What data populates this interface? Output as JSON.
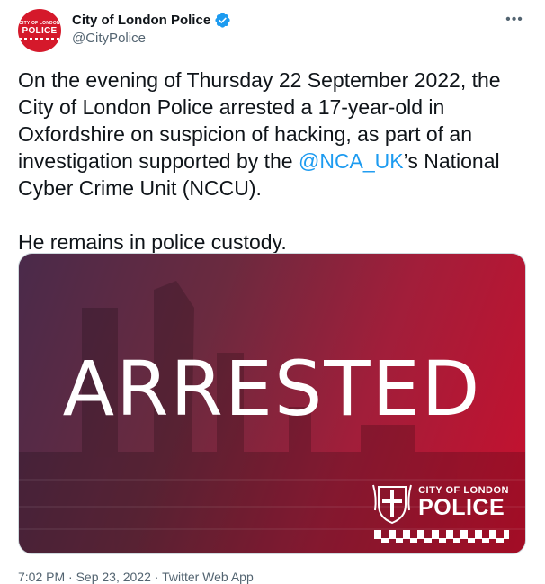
{
  "author": {
    "display_name": "City of London Police",
    "handle": "@CityPolice",
    "avatar_text_small": "CITY OF LONDON",
    "avatar_text_big": "POLICE"
  },
  "icons": {
    "verified": "verified-badge-icon",
    "more": "more-options-icon",
    "crest": "city-of-london-crest-icon"
  },
  "tweet": {
    "text_part1": "On the evening of Thursday 22 September 2022, the City of London Police arrested a 17-year-old in Oxfordshire on suspicion of hacking, as part of an investigation supported by the ",
    "mention": "@NCA_UK",
    "text_part2": "’s National Cyber Crime Unit (NCCU).",
    "paragraph2": "He remains in police custody."
  },
  "media": {
    "headline": "ARRESTED",
    "logo_top": "CITY OF LONDON",
    "logo_bottom": "POLICE"
  },
  "meta": {
    "timestamp": "7:02 PM · Sep 23, 2022 · Twitter Web App"
  },
  "colors": {
    "link": "#1d9bf0",
    "brand_red": "#c8102e",
    "text": "#0f1419",
    "secondary": "#536471"
  }
}
